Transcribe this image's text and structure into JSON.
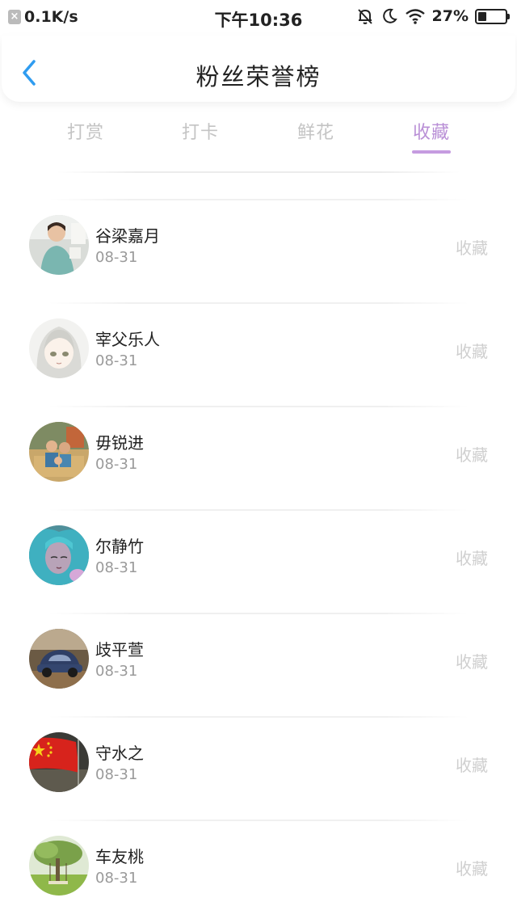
{
  "status_bar": {
    "speed": "0.1K/s",
    "time": "下午10:36",
    "battery": "27%",
    "battery_level": 0.27
  },
  "header": {
    "title": "粉丝荣誉榜"
  },
  "tabs": [
    {
      "label": "打赏",
      "active": false
    },
    {
      "label": "打卡",
      "active": false
    },
    {
      "label": "鲜花",
      "active": false
    },
    {
      "label": "收藏",
      "active": true
    }
  ],
  "colors": {
    "accent": "#b98fd6",
    "back_arrow": "#2f9cf0"
  },
  "fans": [
    {
      "name": "谷梁嘉月",
      "date": "08-31",
      "action": "收藏",
      "avatar": "child-photo"
    },
    {
      "name": "宰父乐人",
      "date": "08-31",
      "action": "收藏",
      "avatar": "anime-girl"
    },
    {
      "name": "毋锐进",
      "date": "08-31",
      "action": "收藏",
      "avatar": "family-photo"
    },
    {
      "name": "尔静竹",
      "date": "08-31",
      "action": "收藏",
      "avatar": "anime-teal-hair"
    },
    {
      "name": "歧平萱",
      "date": "08-31",
      "action": "收藏",
      "avatar": "vintage-car"
    },
    {
      "name": "守水之",
      "date": "08-31",
      "action": "收藏",
      "avatar": "red-flag"
    },
    {
      "name": "车友桃",
      "date": "08-31",
      "action": "收藏",
      "avatar": "tree-swing"
    }
  ]
}
